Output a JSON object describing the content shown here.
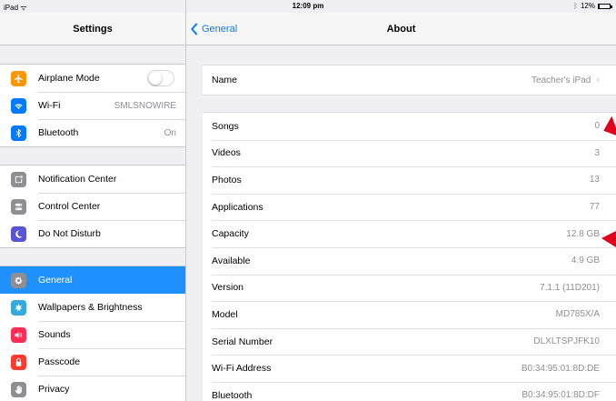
{
  "status": {
    "device": "iPad",
    "time": "12:09 pm",
    "battery": "12%",
    "battery_level": 0.12
  },
  "sidebar": {
    "title": "Settings",
    "groups": [
      [
        {
          "label": "Airplane Mode",
          "icon": "airplane-icon",
          "color": "#ff9500",
          "toggle": false
        },
        {
          "label": "Wi-Fi",
          "icon": "wifi-icon",
          "color": "#007aff",
          "value": "SMLSNOWIRE"
        },
        {
          "label": "Bluetooth",
          "icon": "bluetooth-icon",
          "color": "#007aff",
          "value": "On"
        }
      ],
      [
        {
          "label": "Notification Center",
          "icon": "notification-center-icon",
          "color": "#8e8e93"
        },
        {
          "label": "Control Center",
          "icon": "control-center-icon",
          "color": "#8e8e93"
        },
        {
          "label": "Do Not Disturb",
          "icon": "moon-icon",
          "color": "#5856d6"
        }
      ],
      [
        {
          "label": "General",
          "icon": "gear-icon",
          "color": "#8e8e93",
          "selected": true
        },
        {
          "label": "Wallpapers & Brightness",
          "icon": "wallpaper-icon",
          "color": "#34aadc"
        },
        {
          "label": "Sounds",
          "icon": "speaker-icon",
          "color": "#ff2d55"
        },
        {
          "label": "Passcode",
          "icon": "lock-icon",
          "color": "#ff3b30"
        },
        {
          "label": "Privacy",
          "icon": "hand-icon",
          "color": "#8e8e93"
        }
      ]
    ]
  },
  "detail": {
    "back_label": "General",
    "title": "About",
    "name_row": {
      "label": "Name",
      "value": "Teacher's iPad"
    },
    "rows": [
      {
        "label": "Songs",
        "value": "0"
      },
      {
        "label": "Videos",
        "value": "3"
      },
      {
        "label": "Photos",
        "value": "13"
      },
      {
        "label": "Applications",
        "value": "77"
      },
      {
        "label": "Capacity",
        "value": "12.8 GB"
      },
      {
        "label": "Available",
        "value": "4.9 GB"
      },
      {
        "label": "Version",
        "value": "7.1.1 (11D201)"
      },
      {
        "label": "Model",
        "value": "MD785X/A"
      },
      {
        "label": "Serial Number",
        "value": "DLXLTSPJFK10"
      },
      {
        "label": "Wi-Fi Address",
        "value": "B0:34:95:01:8D:DE"
      },
      {
        "label": "Bluetooth",
        "value": "B0:34:95:01:8D:DF"
      }
    ]
  },
  "colors": {
    "accent": "#007aff",
    "selected": "#1e90ff",
    "annotation": "#e0001b"
  }
}
